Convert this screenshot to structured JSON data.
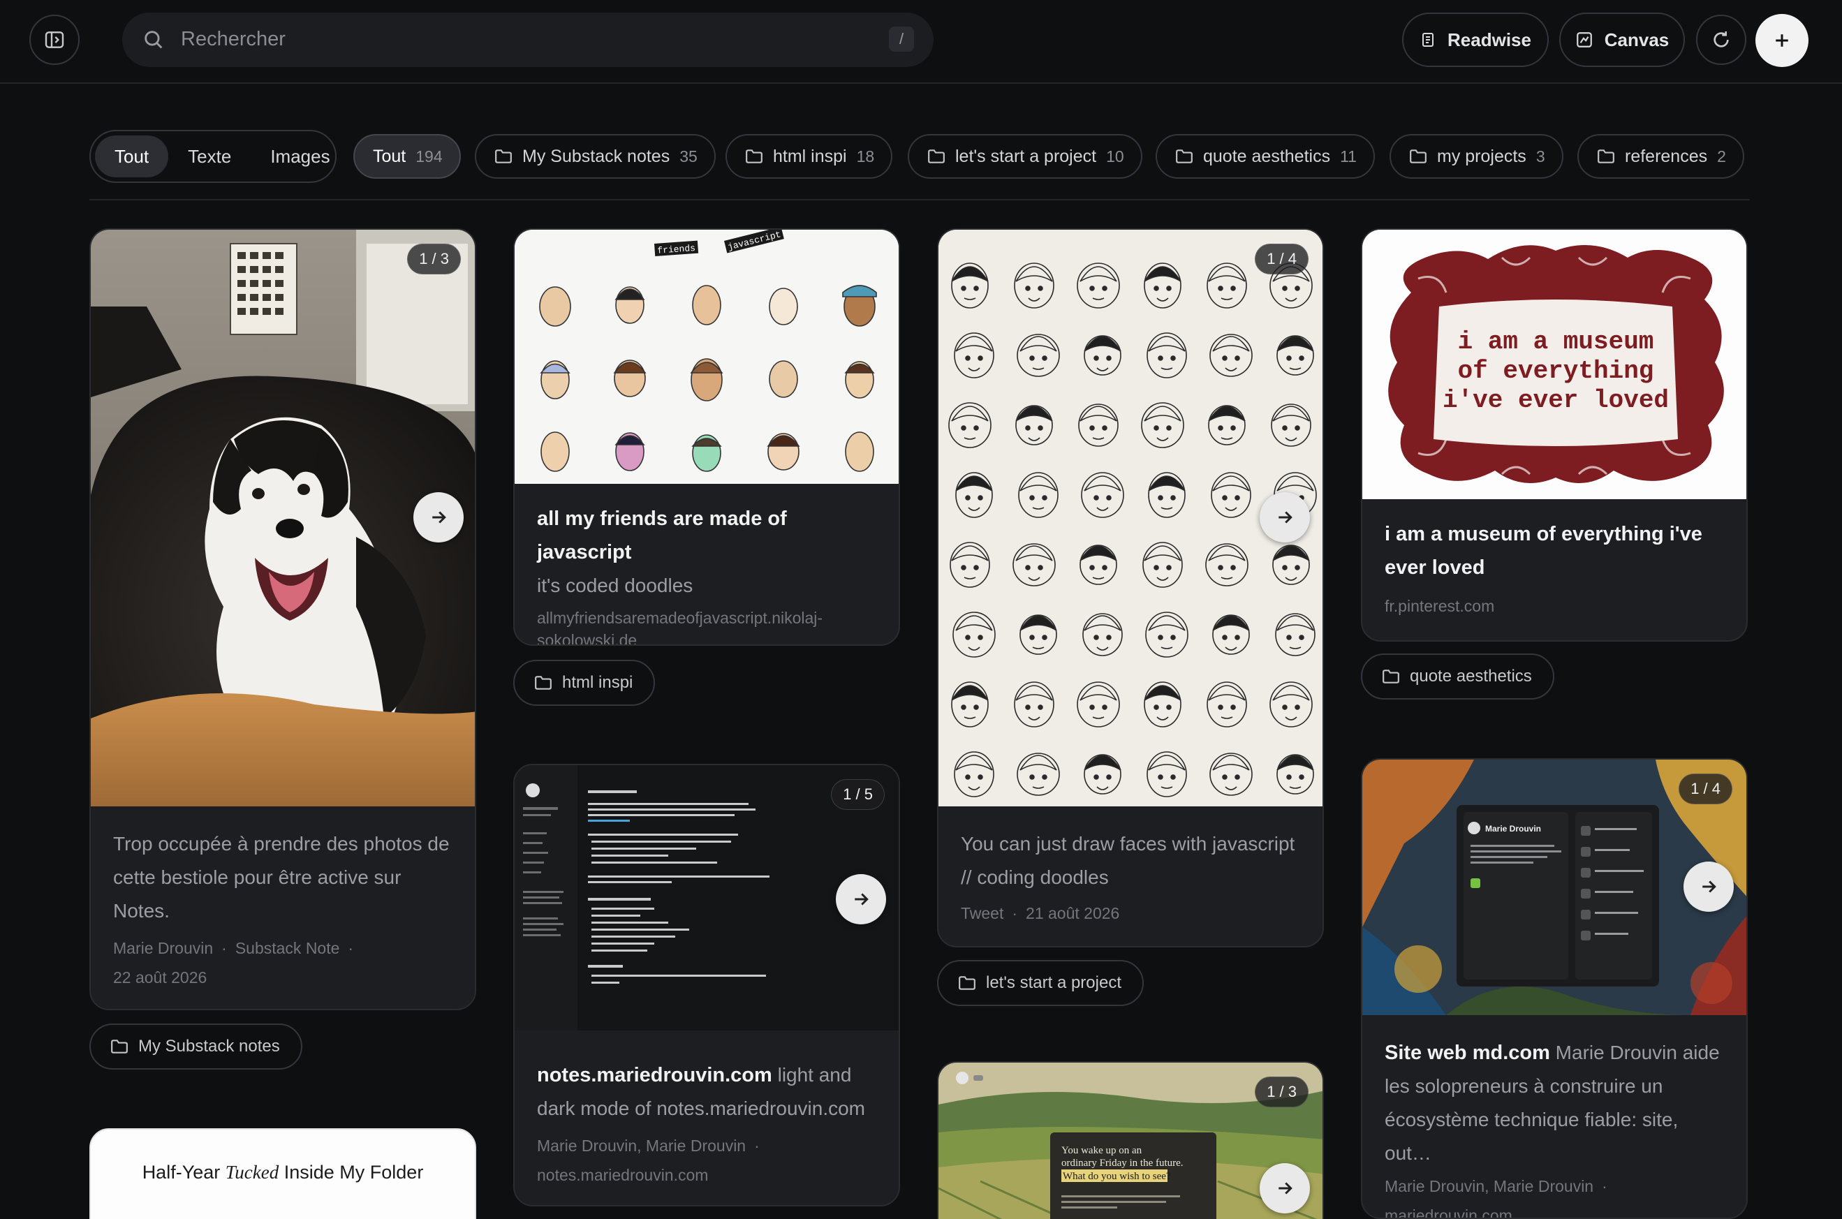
{
  "search": {
    "placeholder": "Rechercher",
    "shortcut": "/"
  },
  "header_actions": {
    "readwise_label": "Readwise",
    "canvas_label": "Canvas"
  },
  "type_filter": {
    "items": [
      "Tout",
      "Texte",
      "Images"
    ],
    "selected": "Tout"
  },
  "collections": [
    {
      "label": "Tout",
      "count": "194",
      "active": true
    },
    {
      "label": "My Substack notes",
      "count": "35"
    },
    {
      "label": "html inspi",
      "count": "18"
    },
    {
      "label": "let's start a project",
      "count": "10"
    },
    {
      "label": "quote aesthetics",
      "count": "11"
    },
    {
      "label": "my projects",
      "count": "3"
    },
    {
      "label": "references",
      "count": "2"
    }
  ],
  "cards": {
    "dog": {
      "badge": "1 / 3",
      "desc": "Trop occupée à prendre des photos de cette bestiole pour être active sur Notes.",
      "author": "Marie Drouvin",
      "type": "Substack Note",
      "date": "22 août 2026",
      "tag": "My Substack notes"
    },
    "friends": {
      "image_text_1": "friends",
      "image_text_2": "javascript",
      "title": "all my friends are made of javascript",
      "desc": "it's coded doodles",
      "domain": "allmyfriendsaremadeofjavascript.nikolaj-sokolowski.de",
      "tag": "html inspi"
    },
    "faces": {
      "badge": "1 / 4",
      "desc": "You can just draw faces with javascript // coding doodles",
      "type": "Tweet",
      "date": "21 août 2026",
      "tag": "let's start a project"
    },
    "museum": {
      "image_text": [
        "i am a museum",
        "of   everything",
        "i've  ever  loved"
      ],
      "title": "i am a museum of everything i've ever loved",
      "domain": "fr.pinterest.com",
      "tag": "quote aesthetics"
    },
    "notes": {
      "badge": "1 / 5",
      "title": "notes.mariedrouvin.com",
      "desc": "light and dark mode of notes.mariedrouvin.com",
      "authors": "Marie Drouvin, Marie Drouvin",
      "domain": "notes.mariedrouvin.com"
    },
    "site": {
      "badge": "1 / 4",
      "title": "Site web md.com",
      "desc": "Marie Drouvin aide les solopreneurs à construire un écosystème technique fiable: site, out…",
      "authors": "Marie Drouvin, Marie Drouvin",
      "domain": "mariedrouvin.com",
      "screen_name": "Marie Drouvin"
    },
    "halfyear": {
      "text_before": "Half-Year ",
      "text_italic": "Tucked",
      "text_after": " Inside My Folder"
    },
    "friday": {
      "badge": "1 / 3",
      "line1": "You wake up on an",
      "line2": "ordinary Friday in the future.",
      "line3": "What do you wish to see?"
    }
  },
  "colors": {
    "background": "#0e0f11",
    "card": "#1c1e21",
    "museum_red": "#7d1d21"
  }
}
